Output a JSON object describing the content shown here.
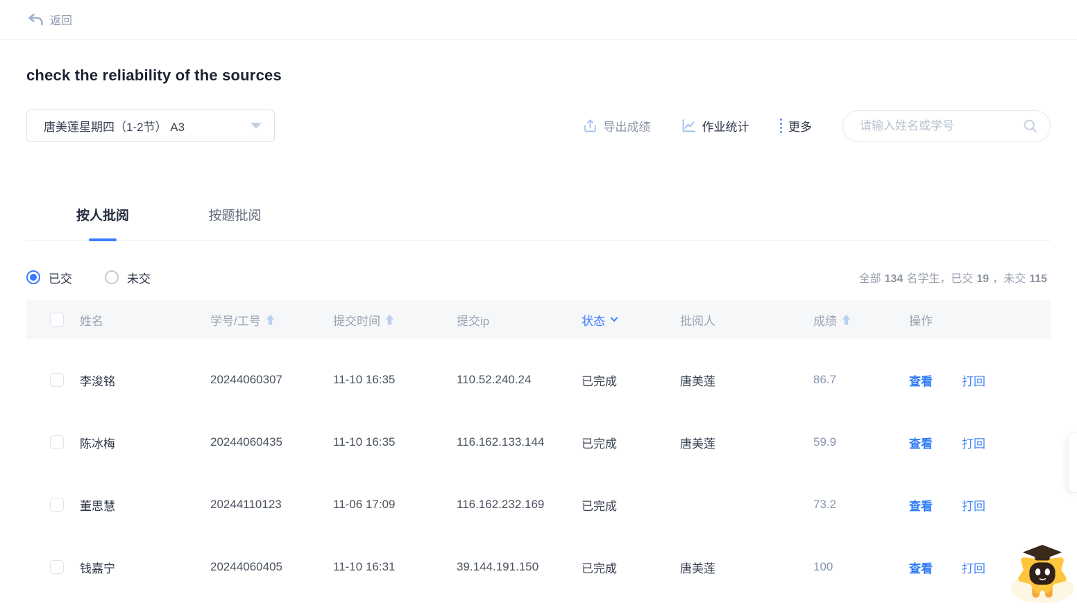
{
  "topbar": {
    "back_label": "返回"
  },
  "page": {
    "title": "check the reliability of the sources"
  },
  "controls": {
    "class_value": "唐美莲星期四（1-2节） A3",
    "export_label": "导出成绩",
    "stats_label": "作业统计",
    "more_label": "更多",
    "search_placeholder": "请输入姓名或学号"
  },
  "tabs": [
    {
      "label": "按人批阅",
      "active": true
    },
    {
      "label": "按题批阅",
      "active": false
    }
  ],
  "filters": {
    "radios": [
      {
        "label": "已交",
        "selected": true
      },
      {
        "label": "未交",
        "selected": false
      }
    ],
    "summary": {
      "p1": "全部",
      "n1": "134",
      "p2": "名学生，已交",
      "n2": "19",
      "p3": "，未交",
      "n3": "115"
    }
  },
  "table": {
    "headers": {
      "name": "姓名",
      "id": "学号/工号",
      "time": "提交时间",
      "ip": "提交ip",
      "status": "状态",
      "reviewer": "批阅人",
      "score": "成绩",
      "actions": "操作"
    },
    "action_view": "查看",
    "action_return": "打回",
    "rows": [
      {
        "name": "李浚铭",
        "id": "20244060307",
        "time": "11-10 16:35",
        "ip": "110.52.240.24",
        "status": "已完成",
        "reviewer": "唐美莲",
        "score": "86.7"
      },
      {
        "name": "陈冰梅",
        "id": "20244060435",
        "time": "11-10 16:35",
        "ip": "116.162.133.144",
        "status": "已完成",
        "reviewer": "唐美莲",
        "score": "59.9"
      },
      {
        "name": "董思慧",
        "id": "20244110123",
        "time": "11-06 17:09",
        "ip": "116.162.232.169",
        "status": "已完成",
        "reviewer": "",
        "score": "73.2"
      },
      {
        "name": "钱嘉宁",
        "id": "20244060405",
        "time": "11-10 16:31",
        "ip": "39.144.191.150",
        "status": "已完成",
        "reviewer": "唐美莲",
        "score": "100"
      }
    ]
  },
  "icons": {
    "back": "undo-arrow",
    "export": "upload-tray",
    "stats": "line-chart",
    "more": "vertical-dots",
    "search": "magnifier",
    "select_caret": "triangle-down",
    "sort": "arrow-up",
    "status_filter": "chevron-down",
    "mascot": "graduate-owl-on-cloud"
  },
  "colors": {
    "primary_blue": "#3b7cfe",
    "link_blue": "#2e7bf6",
    "icon_light_blue": "#a5c3ee",
    "text_dark": "#2b3547",
    "text_gray": "#98a1b0",
    "score_gray": "#8795ae",
    "header_bg": "#f6f7f9",
    "border": "#ebeef2",
    "mascot_yellow": "#ffc53d"
  }
}
